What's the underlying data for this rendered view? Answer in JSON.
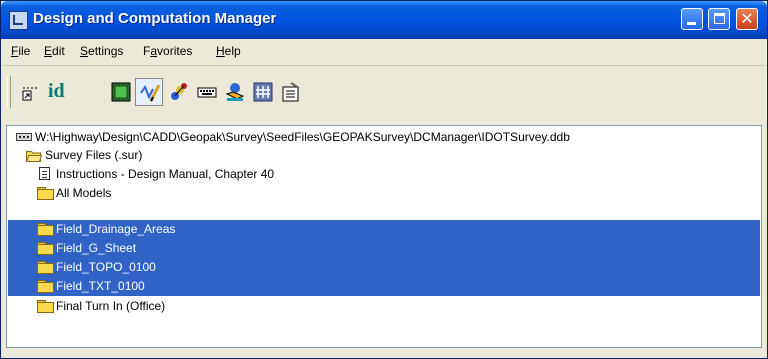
{
  "window": {
    "title": "Design and Computation Manager",
    "controls": {
      "minimize": "minimize",
      "maximize": "maximize",
      "close": "close"
    }
  },
  "menu": [
    {
      "label": "File",
      "accel": "F",
      "rest": "ile"
    },
    {
      "label": "Edit",
      "accel": "E",
      "rest": "dit"
    },
    {
      "label": "Settings",
      "accel": "S",
      "rest": "ettings"
    },
    {
      "label": "Favorites",
      "pre": "F",
      "accel": "a",
      "rest": "vorites"
    },
    {
      "label": "Help",
      "accel": "H",
      "rest": "elp"
    }
  ],
  "toolbar": {
    "id_label": "id",
    "icons": [
      "place-point-icon",
      "identify-icon",
      "display-icon",
      "draw-icon",
      "palette-icon",
      "keyboard-icon",
      "highlight-icon",
      "tools-icon",
      "properties-icon"
    ]
  },
  "tree": {
    "database_path": "W:\\Highway\\Design\\CADD\\Geopak\\Survey\\SeedFiles\\GEOPAKSurvey\\DCManager\\IDOTSurvey.ddb",
    "category": "Survey Files (.sur)",
    "items": [
      {
        "label": "Instructions  - Design Manual, Chapter 40",
        "icon": "document-icon",
        "selected": false
      },
      {
        "label": "All Models",
        "icon": "folder-icon",
        "selected": false
      },
      {
        "label": "Field_Drainage_Areas",
        "icon": "folder-icon",
        "selected": true
      },
      {
        "label": "Field_G_Sheet",
        "icon": "folder-icon",
        "selected": true
      },
      {
        "label": "Field_TOPO_0100",
        "icon": "folder-icon",
        "selected": true
      },
      {
        "label": "Field_TXT_0100",
        "icon": "folder-icon",
        "selected": true
      },
      {
        "label": "Final Turn In (Office)",
        "icon": "folder-icon",
        "selected": false
      }
    ]
  },
  "colors": {
    "selection": "#3163c6",
    "titlebar": "#0054e3",
    "folder": "#f7d94e"
  }
}
